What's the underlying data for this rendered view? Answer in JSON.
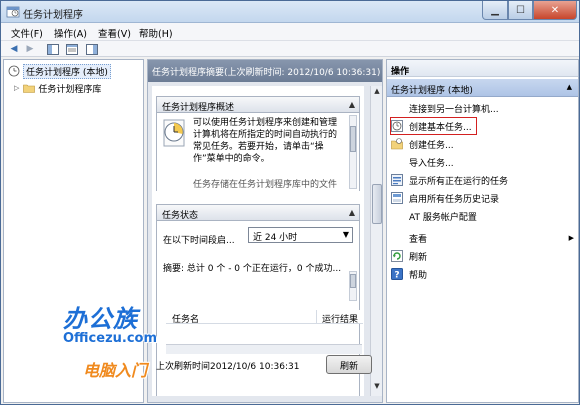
{
  "window": {
    "title": "任务计划程序"
  },
  "menu": {
    "file": "文件(F)",
    "action": "操作(A)",
    "view": "查看(V)",
    "help": "帮助(H)"
  },
  "tree": {
    "root": "任务计划程序 (本地)",
    "library": "任务计划程序库"
  },
  "center": {
    "header": "任务计划程序摘要(上次刷新时间: 2012/10/6 10:36:31)",
    "overview": {
      "title": "任务计划程序概述",
      "text": "可以使用任务计划程序来创建和管理计算机将在所指定的时间自动执行的常见任务。若要开始，请单击“操作”菜单中的命令。",
      "text2": "任务存储在任务计划程序库中的文件"
    },
    "status": {
      "title": "任务状态",
      "period_label": "在以下时间段启...",
      "period_value": "近 24 小时",
      "summary": "摘要: 总计 0 个 - 0 个正在运行，0 个成功..."
    },
    "columns": [
      "任务名",
      "运行结果"
    ],
    "last_refresh": "上次刷新时间2012/10/6 10:36:31",
    "refresh_button": "刷新"
  },
  "actions": {
    "header": "操作",
    "section": "任务计划程序 (本地)",
    "items": [
      {
        "label": "连接到另一台计算机...",
        "icon": "none"
      },
      {
        "label": "创建基本任务...",
        "icon": "clock-task-icon"
      },
      {
        "label": "创建任务...",
        "icon": "task-folder-icon"
      },
      {
        "label": "导入任务...",
        "icon": "none"
      },
      {
        "label": "显示所有正在运行的任务",
        "icon": "running-tasks-icon"
      },
      {
        "label": "启用所有任务历史记录",
        "icon": "history-icon"
      },
      {
        "label": "AT 服务帐户配置",
        "icon": "none"
      },
      {
        "label": "查看",
        "icon": "none"
      },
      {
        "label": "刷新",
        "icon": "refresh-icon"
      },
      {
        "label": "帮助",
        "icon": "help-icon"
      }
    ]
  },
  "watermark": {
    "brand": "办公族",
    "domain": "Officezu.com",
    "slogan": "电脑入门"
  },
  "colors": {
    "accent": "#2a6ebf",
    "highlight": "#d32020",
    "watermark_blue": "#1d6fd6",
    "watermark_orange": "#f08a1e"
  }
}
